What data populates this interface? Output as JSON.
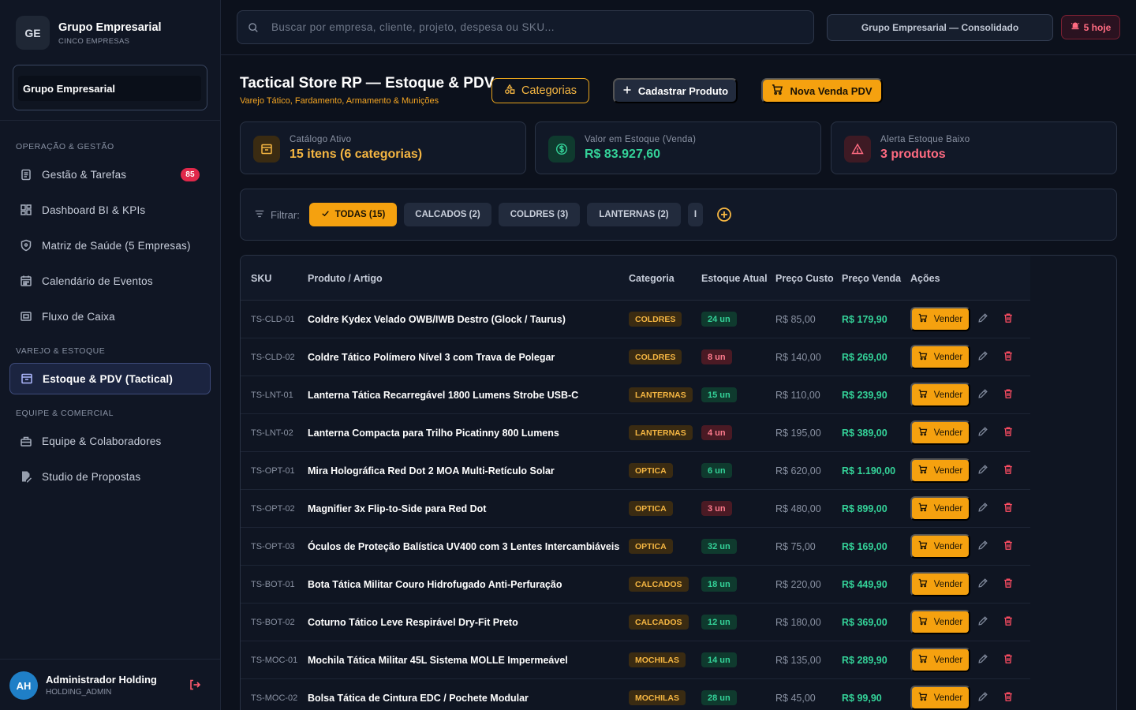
{
  "brand": {
    "initials": "GE",
    "name": "Grupo Empresarial",
    "subtitle": "CINCO EMPRESAS"
  },
  "org_selector": {
    "value": "Grupo Empresarial"
  },
  "sidebar": {
    "sections": [
      {
        "title": "OPERAÇÃO & GESTÃO",
        "items": [
          {
            "label": "Gestão & Tarefas",
            "icon": "clipboard-icon",
            "badge": "85"
          },
          {
            "label": "Dashboard BI & KPIs",
            "icon": "dashboard-icon"
          },
          {
            "label": "Matriz de Saúde (5 Empresas)",
            "icon": "shield-icon"
          },
          {
            "label": "Calendário de Eventos",
            "icon": "calendar-icon"
          },
          {
            "label": "Fluxo de Caixa",
            "icon": "cash-icon"
          }
        ]
      },
      {
        "title": "VAREJO & ESTOQUE",
        "items": [
          {
            "label": "Estoque & PDV (Tactical)",
            "icon": "archive-icon",
            "active": true
          }
        ]
      },
      {
        "title": "EQUIPE & COMERCIAL",
        "items": [
          {
            "label": "Equipe & Colaboradores",
            "icon": "team-icon"
          },
          {
            "label": "Studio de Propostas",
            "icon": "document-edit-icon"
          }
        ]
      }
    ]
  },
  "user": {
    "initials": "AH",
    "name": "Administrador Holding",
    "role": "HOLDING_ADMIN"
  },
  "topbar": {
    "search_placeholder": "Buscar por empresa, cliente, projeto, despesa ou SKU...",
    "consolidated_label": "Grupo Empresarial — Consolidado",
    "alerts_label": "5 hoje"
  },
  "header": {
    "title": "Tactical Store RP — Estoque & PDV",
    "subtitle": "Varejo Tático, Fardamento, Armamento & Munições",
    "categories_button": "Categorias",
    "new_product_button": "Cadastrar Produto",
    "new_sale_button": "Nova Venda PDV"
  },
  "stats": [
    {
      "label": "Catálogo Ativo",
      "value": "15 itens (6 categorias)",
      "color": "#f5b642",
      "icon": "archive-icon"
    },
    {
      "label": "Valor em Estoque (Venda)",
      "value": "R$ 83.927,60",
      "color": "#34d399",
      "icon": "dollar-icon"
    },
    {
      "label": "Alerta Estoque Baixo",
      "value": "3 produtos",
      "color": "#ff6b81",
      "icon": "warning-icon"
    }
  ],
  "filter": {
    "label": "Filtrar:",
    "chips": [
      "TODAS (15)",
      "CALCADOS (2)",
      "COLDRES (3)",
      "LANTERNAS (2)",
      "I"
    ]
  },
  "table": {
    "columns": [
      "SKU",
      "Produto / Artigo",
      "Categoria",
      "Estoque Atual",
      "Preço Custo",
      "Preço Venda",
      "Ações"
    ],
    "sell_label": "Vender",
    "rows": [
      {
        "sku": "TS-CLD-01",
        "name": "Coldre Kydex Velado OWB/IWB Destro (Glock / Taurus)",
        "category": "COLDRES",
        "stock": "24 un",
        "low": false,
        "cost": "R$ 85,00",
        "price": "R$ 179,90"
      },
      {
        "sku": "TS-CLD-02",
        "name": "Coldre Tático Polímero Nível 3 com Trava de Polegar",
        "category": "COLDRES",
        "stock": "8 un",
        "low": true,
        "cost": "R$ 140,00",
        "price": "R$ 269,00"
      },
      {
        "sku": "TS-LNT-01",
        "name": "Lanterna Tática Recarregável 1800 Lumens Strobe USB-C",
        "category": "LANTERNAS",
        "stock": "15 un",
        "low": false,
        "cost": "R$ 110,00",
        "price": "R$ 239,90"
      },
      {
        "sku": "TS-LNT-02",
        "name": "Lanterna Compacta para Trilho Picatinny 800 Lumens",
        "category": "LANTERNAS",
        "stock": "4 un",
        "low": true,
        "cost": "R$ 195,00",
        "price": "R$ 389,00"
      },
      {
        "sku": "TS-OPT-01",
        "name": "Mira Holográfica Red Dot 2 MOA Multi-Retículo Solar",
        "category": "OPTICA",
        "stock": "6 un",
        "low": false,
        "cost": "R$ 620,00",
        "price": "R$ 1.190,00"
      },
      {
        "sku": "TS-OPT-02",
        "name": "Magnifier 3x Flip-to-Side para Red Dot",
        "category": "OPTICA",
        "stock": "3 un",
        "low": true,
        "cost": "R$ 480,00",
        "price": "R$ 899,00"
      },
      {
        "sku": "TS-OPT-03",
        "name": "Óculos de Proteção Balística UV400 com 3 Lentes Intercambiáveis",
        "category": "OPTICA",
        "stock": "32 un",
        "low": false,
        "cost": "R$ 75,00",
        "price": "R$ 169,00"
      },
      {
        "sku": "TS-BOT-01",
        "name": "Bota Tática Militar Couro Hidrofugado Anti-Perfuração",
        "category": "CALCADOS",
        "stock": "18 un",
        "low": false,
        "cost": "R$ 220,00",
        "price": "R$ 449,90"
      },
      {
        "sku": "TS-BOT-02",
        "name": "Coturno Tático Leve Respirável Dry-Fit Preto",
        "category": "CALCADOS",
        "stock": "12 un",
        "low": false,
        "cost": "R$ 180,00",
        "price": "R$ 369,00"
      },
      {
        "sku": "TS-MOC-01",
        "name": "Mochila Tática Militar 45L Sistema MOLLE Impermeável",
        "category": "MOCHILAS",
        "stock": "14 un",
        "low": false,
        "cost": "R$ 135,00",
        "price": "R$ 289,90"
      },
      {
        "sku": "TS-MOC-02",
        "name": "Bolsa Tática de Cintura EDC / Pochete Modular",
        "category": "MOCHILAS",
        "stock": "28 un",
        "low": false,
        "cost": "R$ 45,00",
        "price": "R$ 99,90"
      }
    ]
  }
}
